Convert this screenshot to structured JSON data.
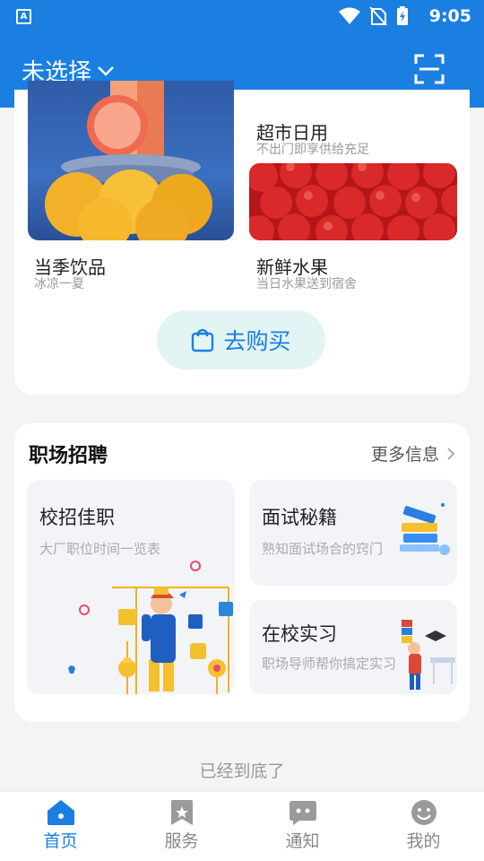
{
  "appbar": {
    "location": "未选择"
  },
  "shop": {
    "tiles": [
      {
        "title": "当季饮品",
        "subtitle": "冰凉一夏"
      },
      {
        "title": "超市日用",
        "subtitle": "不出门即享供给充足"
      },
      {
        "title": "新鲜水果",
        "subtitle": "当日水果送到宿舍"
      }
    ],
    "buy_label": "去购买"
  },
  "jobs": {
    "title": "职场招聘",
    "more_label": "更多信息",
    "cards": [
      {
        "title": "校招佳职",
        "subtitle": "大厂职位时间一览表"
      },
      {
        "title": "面试秘籍",
        "subtitle": "熟知面试场合的窍门"
      },
      {
        "title": "在校实习",
        "subtitle": "职场导师帮你搞定实习"
      }
    ]
  },
  "end_hint": "已经到底了",
  "tabs": [
    {
      "label": "首页",
      "icon": "home-icon",
      "active": true
    },
    {
      "label": "服务",
      "icon": "bookmark-icon",
      "active": false
    },
    {
      "label": "通知",
      "icon": "message-icon",
      "active": false
    },
    {
      "label": "我的",
      "icon": "profile-icon",
      "active": false
    }
  ],
  "status": {
    "time": "9:05"
  },
  "colors": {
    "primary": "#1a7fe0",
    "button_bg": "#e2f4f3"
  }
}
